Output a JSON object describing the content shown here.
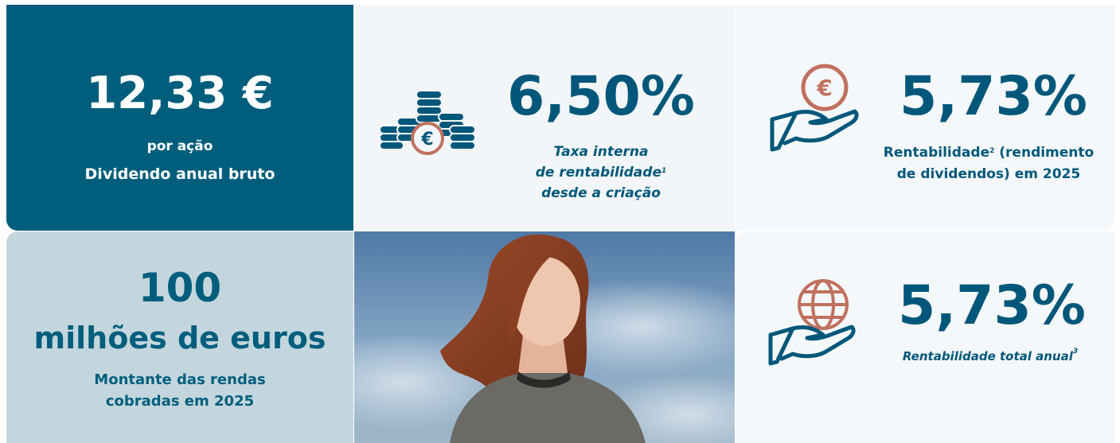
{
  "dividend": {
    "value": "12,33 €",
    "sub": "por ação",
    "label": "Dividendo anual bruto"
  },
  "irr": {
    "value": "6,50%",
    "line1": "Taxa interna",
    "line2_text": "de rentabilidade",
    "line2_sup": "1",
    "line3": "desde a criação",
    "icon": "coins-euro-icon"
  },
  "dividend_yield": {
    "value": "5,73%",
    "line1_text": "Rentabilidade",
    "line1_sup": "2",
    "line1_rest": " (rendimento",
    "line2": "de dividendos) em 2025",
    "icon": "hand-euro-coin-icon"
  },
  "rents": {
    "value": "100",
    "unit": "milhões de euros",
    "line1": "Montante das rendas",
    "line2": "cobradas em 2025"
  },
  "total_return": {
    "value": "5,73%",
    "label_text": "Rentabilidade total anual",
    "label_sup": "3",
    "icon": "hand-globe-icon"
  },
  "colors": {
    "primary": "#005e7c",
    "accent": "#c0715f",
    "light_tile": "#f4f8fa",
    "rent_tile": "#c3d6dd"
  }
}
